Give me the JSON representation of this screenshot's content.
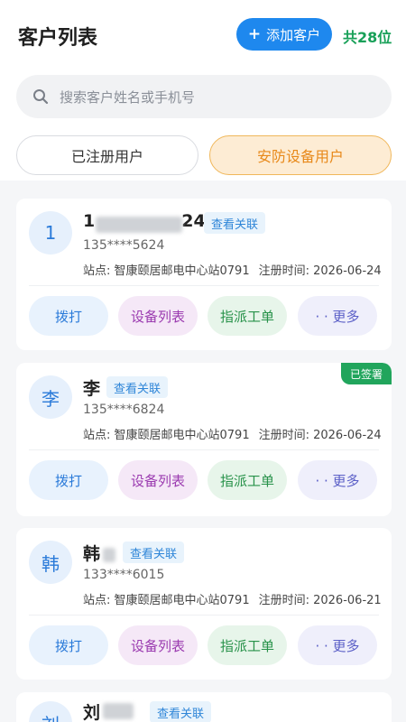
{
  "header": {
    "title": "客户列表",
    "add_label": "添加客户",
    "count": "共28位"
  },
  "search": {
    "placeholder": "搜索客户姓名或手机号"
  },
  "tabs": [
    {
      "label": "已注册用户"
    },
    {
      "label": "安防设备用户"
    }
  ],
  "customers": [
    {
      "avatar": "1",
      "name": "1",
      "name_tail": "24",
      "link": "查看关联",
      "phone": "135****5624",
      "station": "站点: 智康颐居邮电中心站0791",
      "reg_time": "注册时间: 2026-06-24",
      "badge": ""
    },
    {
      "avatar": "李",
      "name": "李",
      "name_tail": "",
      "link": "查看关联",
      "phone": "135****6824",
      "station": "站点: 智康颐居邮电中心站0791",
      "reg_time": "注册时间: 2026-06-24",
      "badge": "已签署"
    },
    {
      "avatar": "韩",
      "name": "韩",
      "name_tail": "",
      "link": "查看关联",
      "phone": "133****6015",
      "station": "站点: 智康颐居邮电中心站0791",
      "reg_time": "注册时间: 2026-06-21",
      "badge": ""
    },
    {
      "avatar": "刘",
      "name": "刘",
      "name_tail": "",
      "link": "查看关联",
      "phone": "",
      "station": "",
      "reg_time": "",
      "badge": ""
    }
  ],
  "actions": {
    "call": "拨打",
    "devices": "设备列表",
    "order": "指派工单",
    "more": "· · 更多"
  },
  "icons": {
    "search": "search-icon",
    "plus": "plus-icon"
  },
  "colors": {
    "primary": "#1e88ee",
    "green": "#18a058",
    "orange": "#e8891a"
  }
}
